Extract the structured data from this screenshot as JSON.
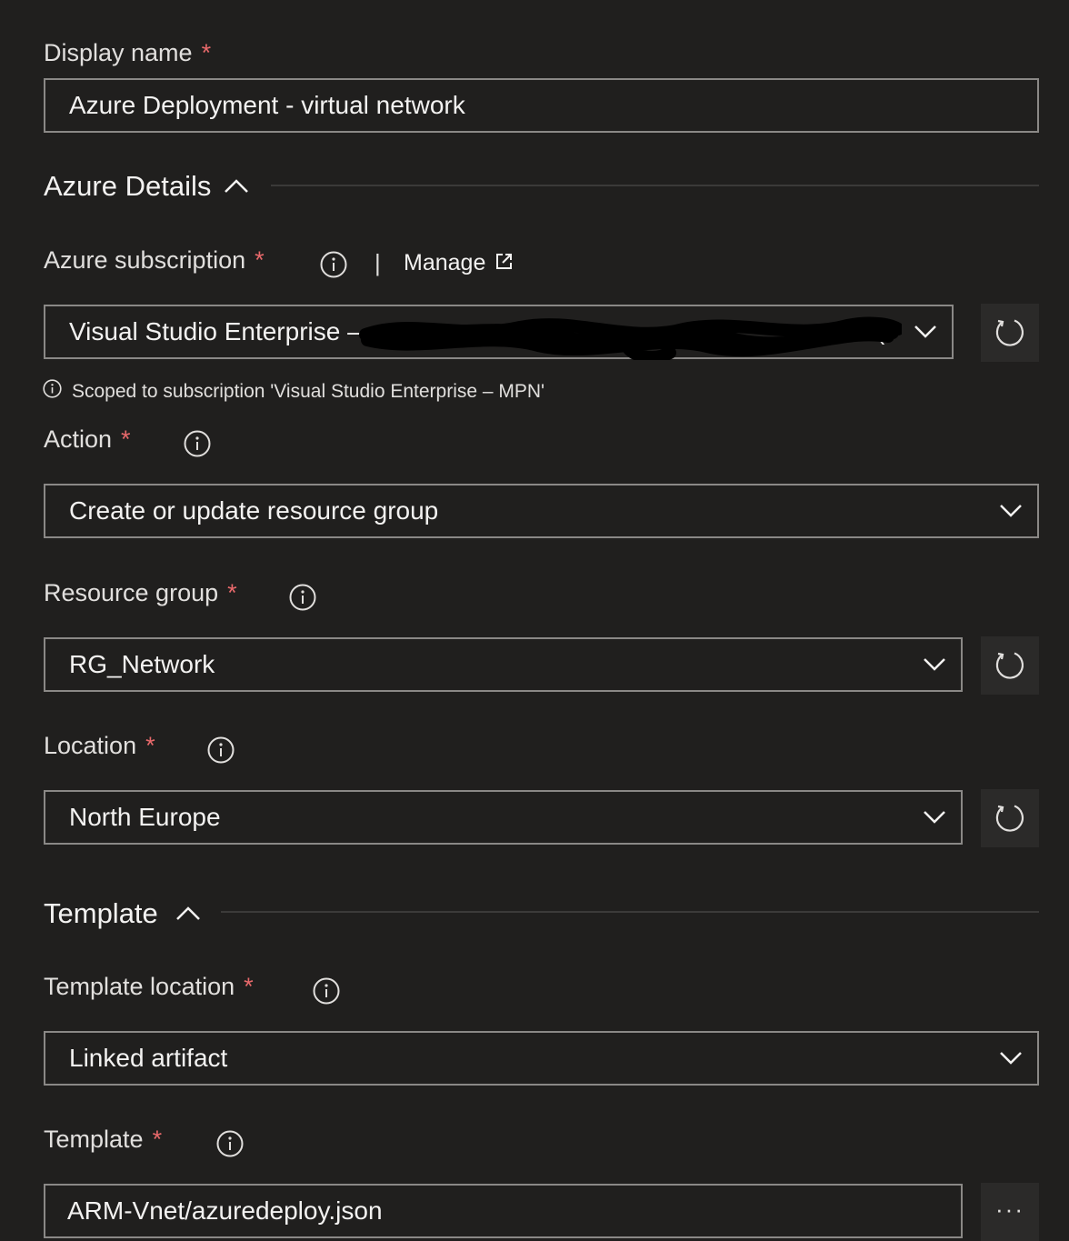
{
  "display_name": {
    "label": "Display name",
    "required_mark": "*",
    "value": "Azure Deployment - virtual network"
  },
  "azure_details": {
    "title": "Azure Details"
  },
  "subscription": {
    "label": "Azure subscription",
    "required_mark": "*",
    "separator": "|",
    "manage_link": "Manage",
    "value": "Visual Studio Enterprise –",
    "value_tail": "5(",
    "scope_note": "Scoped to subscription 'Visual Studio Enterprise – MPN'"
  },
  "action": {
    "label": "Action",
    "required_mark": "*",
    "value": "Create or update resource group"
  },
  "resource_group": {
    "label": "Resource group",
    "required_mark": "*",
    "value": "RG_Network"
  },
  "location": {
    "label": "Location",
    "required_mark": "*",
    "value": "North Europe"
  },
  "template_section": {
    "title": "Template"
  },
  "template_location": {
    "label": "Template location",
    "required_mark": "*",
    "value": "Linked artifact"
  },
  "template": {
    "label": "Template",
    "required_mark": "*",
    "value": "ARM-Vnet/azuredeploy.json",
    "browse_label": "···"
  },
  "colors": {
    "background": "#201f1e",
    "border": "#8a8886",
    "text": "#e1dfdd",
    "required": "#e8696b"
  }
}
